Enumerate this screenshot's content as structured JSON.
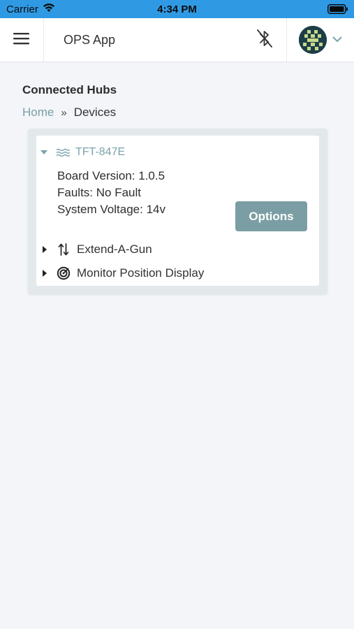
{
  "status_bar": {
    "carrier": "Carrier",
    "time": "4:34 PM"
  },
  "nav": {
    "title": "OPS App",
    "icons": [
      "menu-icon",
      "bluetooth-off-icon",
      "avatar",
      "chevron-down-icon"
    ]
  },
  "page": {
    "title": "Connected Hubs",
    "breadcrumb": {
      "home": "Home",
      "separator": "»",
      "current": "Devices"
    }
  },
  "hub": {
    "name": "TFT-847E",
    "icon": "water-waves-icon",
    "board_version": "Board Version: 1.0.5",
    "faults": "Faults: No Fault",
    "system_voltage": "System Voltage: 14v",
    "options_label": "Options",
    "devices": [
      {
        "label": "Extend-A-Gun",
        "icon": "up-down-arrows-icon"
      },
      {
        "label": "Monitor Position Display",
        "icon": "target-icon"
      }
    ]
  },
  "colors": {
    "status_bar": "#2f9ae3",
    "accent": "#7aa3aa",
    "button": "#7a9ea3",
    "background": "#f3f5f8"
  }
}
